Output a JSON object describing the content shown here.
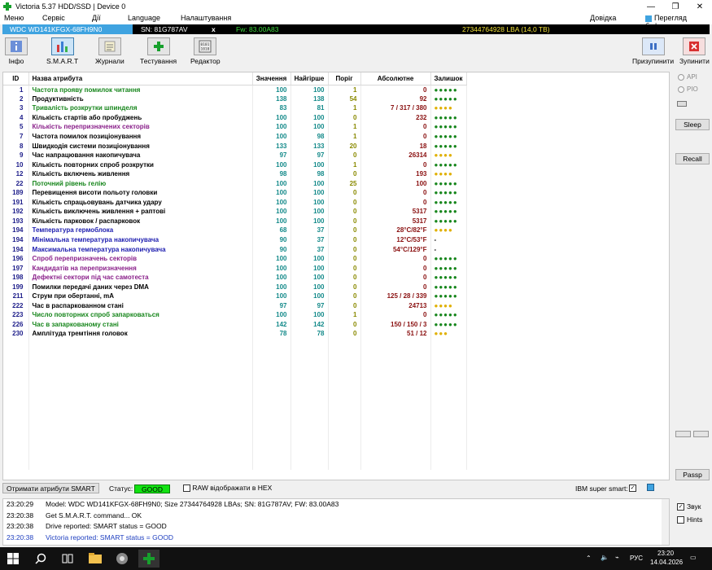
{
  "window": {
    "title": "Victoria 5.37 HDD/SSD | Device 0"
  },
  "menu": {
    "items": [
      "Меню",
      "Сервіс",
      "Дії",
      "Language",
      "Налаштування"
    ],
    "help": "Довідка",
    "buffer_view": "Перегляд буфера"
  },
  "device": {
    "model": "WDC WD141KFGX-68FH9N0",
    "serial": "SN: 81G787AV",
    "fw": "Fw: 83.00A83",
    "lba": "27344764928 LBA (14,0 TB)"
  },
  "toolbar": {
    "items": [
      "Інфо",
      "S.M.A.R.T",
      "Журнали",
      "Тестування",
      "Редактор"
    ],
    "pause": "Призупинити",
    "stop": "Зупинити"
  },
  "smart": {
    "headers": {
      "id": "ID",
      "name": "Назва атрибута",
      "value": "Значення",
      "worst": "Найгірше",
      "threshold": "Поріг",
      "raw": "Абсолютне",
      "health": "Залишок"
    },
    "rows": [
      {
        "id": "1",
        "name": "Частота прояву помилок читання",
        "value": "100",
        "worst": "100",
        "thr": "1",
        "raw": "0",
        "health": "●●●●●",
        "color": "#17861c",
        "hc": "#17861c"
      },
      {
        "id": "2",
        "name": "Продуктивність",
        "value": "138",
        "worst": "138",
        "thr": "54",
        "raw": "92",
        "health": "●●●●●",
        "color": "#000000",
        "hc": "#17861c"
      },
      {
        "id": "3",
        "name": "Тривалість розкрутки шпинделя",
        "value": "83",
        "worst": "81",
        "thr": "1",
        "raw": "7 / 317 / 380",
        "health": "●●●●",
        "color": "#17861c",
        "hc": "#e0b000"
      },
      {
        "id": "4",
        "name": "Кількість стартів або пробуджень",
        "value": "100",
        "worst": "100",
        "thr": "0",
        "raw": "232",
        "health": "●●●●●",
        "color": "#000000",
        "hc": "#17861c"
      },
      {
        "id": "5",
        "name": "Кількість перепризначених секторів",
        "value": "100",
        "worst": "100",
        "thr": "1",
        "raw": "0",
        "health": "●●●●●",
        "color": "#8a208a",
        "hc": "#17861c"
      },
      {
        "id": "7",
        "name": "Частота помилок позиціонування",
        "value": "100",
        "worst": "98",
        "thr": "1",
        "raw": "0",
        "health": "●●●●●",
        "color": "#000000",
        "hc": "#17861c"
      },
      {
        "id": "8",
        "name": "Швидкодія системи позиціонування",
        "value": "133",
        "worst": "133",
        "thr": "20",
        "raw": "18",
        "health": "●●●●●",
        "color": "#000000",
        "hc": "#17861c"
      },
      {
        "id": "9",
        "name": "Час напрацювання накопичувача",
        "value": "97",
        "worst": "97",
        "thr": "0",
        "raw": "26314",
        "health": "●●●●",
        "color": "#000000",
        "hc": "#e0b000"
      },
      {
        "id": "10",
        "name": "Кількість повторних спроб розкрутки",
        "value": "100",
        "worst": "100",
        "thr": "1",
        "raw": "0",
        "health": "●●●●●",
        "color": "#000000",
        "hc": "#17861c"
      },
      {
        "id": "12",
        "name": "Кількість включень живлення",
        "value": "98",
        "worst": "98",
        "thr": "0",
        "raw": "193",
        "health": "●●●●",
        "color": "#000000",
        "hc": "#e0b000"
      },
      {
        "id": "22",
        "name": "Поточний рівень гелію",
        "value": "100",
        "worst": "100",
        "thr": "25",
        "raw": "100",
        "health": "●●●●●",
        "color": "#17861c",
        "hc": "#17861c"
      },
      {
        "id": "189",
        "name": "Перевищення висоти польоту головки",
        "value": "100",
        "worst": "100",
        "thr": "0",
        "raw": "0",
        "health": "●●●●●",
        "color": "#000000",
        "hc": "#17861c"
      },
      {
        "id": "191",
        "name": "Кількість спрацьовувань датчика удару",
        "value": "100",
        "worst": "100",
        "thr": "0",
        "raw": "0",
        "health": "●●●●●",
        "color": "#000000",
        "hc": "#17861c"
      },
      {
        "id": "192",
        "name": "Кількість виключень живлення + раптові",
        "value": "100",
        "worst": "100",
        "thr": "0",
        "raw": "5317",
        "health": "●●●●●",
        "color": "#000000",
        "hc": "#17861c"
      },
      {
        "id": "193",
        "name": "Кількість парковок / распарковок",
        "value": "100",
        "worst": "100",
        "thr": "0",
        "raw": "5317",
        "health": "●●●●●",
        "color": "#000000",
        "hc": "#17861c"
      },
      {
        "id": "194",
        "name": "Температура гермоблока",
        "value": "68",
        "worst": "37",
        "thr": "0",
        "raw": "28°C/82°F",
        "health": "●●●●",
        "color": "#2020b0",
        "hc": "#e0b000"
      },
      {
        "id": "194",
        "name": "Мінімальна температура накопичувача",
        "value": "90",
        "worst": "37",
        "thr": "0",
        "raw": "12°C/53°F",
        "health": "-",
        "color": "#2020b0",
        "hc": "#000000"
      },
      {
        "id": "194",
        "name": "Максимальна температура накопичувача",
        "value": "90",
        "worst": "37",
        "thr": "0",
        "raw": "54°C/129°F",
        "health": "-",
        "color": "#2020b0",
        "hc": "#000000"
      },
      {
        "id": "196",
        "name": "Спроб перепризначень секторів",
        "value": "100",
        "worst": "100",
        "thr": "0",
        "raw": "0",
        "health": "●●●●●",
        "color": "#8a208a",
        "hc": "#17861c"
      },
      {
        "id": "197",
        "name": "Кандидатів на перепризначення",
        "value": "100",
        "worst": "100",
        "thr": "0",
        "raw": "0",
        "health": "●●●●●",
        "color": "#8a208a",
        "hc": "#17861c"
      },
      {
        "id": "198",
        "name": "Дефектні сектори під час самотеста",
        "value": "100",
        "worst": "100",
        "thr": "0",
        "raw": "0",
        "health": "●●●●●",
        "color": "#8a208a",
        "hc": "#17861c"
      },
      {
        "id": "199",
        "name": "Помилки передачі даних через DMA",
        "value": "100",
        "worst": "100",
        "thr": "0",
        "raw": "0",
        "health": "●●●●●",
        "color": "#000000",
        "hc": "#17861c"
      },
      {
        "id": "211",
        "name": "Струм при обертанні, mA",
        "value": "100",
        "worst": "100",
        "thr": "0",
        "raw": "125 / 28 / 339",
        "health": "●●●●●",
        "color": "#000000",
        "hc": "#17861c"
      },
      {
        "id": "222",
        "name": "Час в распаркованном стані",
        "value": "97",
        "worst": "97",
        "thr": "0",
        "raw": "24713",
        "health": "●●●●",
        "color": "#000000",
        "hc": "#e0b000"
      },
      {
        "id": "223",
        "name": "Число повторних спроб запарковаться",
        "value": "100",
        "worst": "100",
        "thr": "1",
        "raw": "0",
        "health": "●●●●●",
        "color": "#17861c",
        "hc": "#17861c"
      },
      {
        "id": "226",
        "name": "Час в запаркованому стані",
        "value": "142",
        "worst": "142",
        "thr": "0",
        "raw": "150 / 150 / 3",
        "health": "●●●●●",
        "color": "#17861c",
        "hc": "#17861c"
      },
      {
        "id": "230",
        "name": "Амплітуда тремтіння головок",
        "value": "78",
        "worst": "78",
        "thr": "0",
        "raw": "51 / 12",
        "health": "●●●",
        "color": "#000000",
        "hc": "#e0b000"
      }
    ]
  },
  "right": {
    "api": "API",
    "pio": "PIO",
    "sleep": "Sleep",
    "recall": "Recall",
    "passp": "Passp"
  },
  "status": {
    "get_button": "Отримати атрибути SMART",
    "label": "Статус:",
    "value": "GOOD",
    "raw_hex": "RAW відображати в HEX",
    "ibm": "IBM super smart:"
  },
  "log": [
    {
      "time": "23:20:29",
      "msg": "Model: WDC WD141KFGX-68FH9N0; Size 27344764928 LBAs; SN: 81G787AV; FW: 83.00A83",
      "color": "#000000"
    },
    {
      "time": "23:20:38",
      "msg": "Get S.M.A.R.T. command... OK",
      "color": "#000000"
    },
    {
      "time": "23:20:38",
      "msg": "Drive reported: SMART status = GOOD",
      "color": "#000000"
    },
    {
      "time": "23:20:38",
      "msg": "Victoria reported: SMART status = GOOD",
      "color": "#2040c0"
    }
  ],
  "side": {
    "sound": "Звук",
    "hints": "Hints"
  },
  "taskbar": {
    "time": "23:20",
    "date": "14.04.2026",
    "lang": "РУС"
  }
}
